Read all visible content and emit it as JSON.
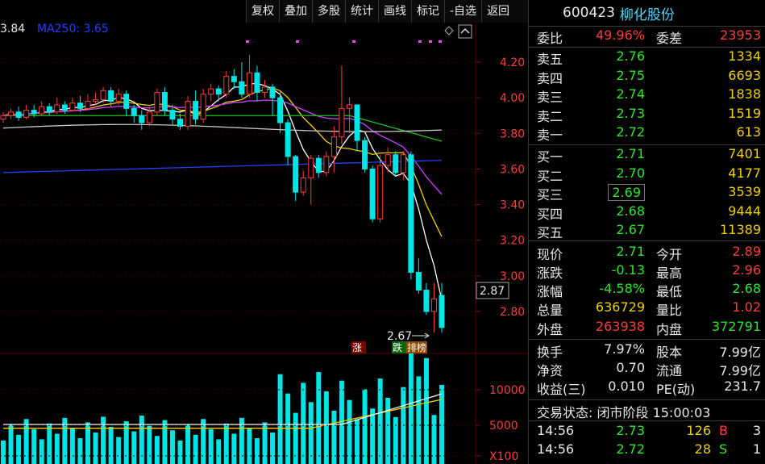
{
  "toolbar": {
    "buttons": [
      "复权",
      "叠加",
      "多股",
      "统计",
      "画线",
      "标记",
      "-自选",
      "返回"
    ]
  },
  "ma_labels": {
    "first": "3.84",
    "ma250": "MA250: 3.65"
  },
  "chart": {
    "price_ticks": [
      "4.20",
      "4.00",
      "3.80",
      "3.60",
      "3.40",
      "3.20",
      "3.00",
      "2.80"
    ],
    "last_price_box": "2.87",
    "min_annotation": "2.67",
    "markers": [
      "涨",
      "跌",
      "排榜"
    ],
    "volume_ticks": [
      "10000",
      "5000",
      "X100"
    ],
    "colors": {
      "up": "#00e5e5",
      "down": "#00e5e5",
      "up_fill": "#000000",
      "ma5": "#ffffff",
      "ma10": "#f0d000",
      "ma20": "#d040ff",
      "ma60": "#20c020",
      "ma120": "#c8c8c8",
      "ma250": "#2040ff",
      "axis_text": "#ff3b3b"
    }
  },
  "stock": {
    "code": "600423",
    "name": "柳化股份"
  },
  "order_book": {
    "weibi_label": "委比",
    "weibi": "49.96%",
    "weicha_label": "委差",
    "weicha": "23953",
    "asks": [
      {
        "label": "卖五",
        "price": "2.76",
        "vol": "1334"
      },
      {
        "label": "卖四",
        "price": "2.75",
        "vol": "6693"
      },
      {
        "label": "卖三",
        "price": "2.74",
        "vol": "1838"
      },
      {
        "label": "卖二",
        "price": "2.73",
        "vol": "1519"
      },
      {
        "label": "卖一",
        "price": "2.72",
        "vol": "613"
      }
    ],
    "bids": [
      {
        "label": "买一",
        "price": "2.71",
        "vol": "7401"
      },
      {
        "label": "买二",
        "price": "2.70",
        "vol": "4177"
      },
      {
        "label": "买三",
        "price": "2.69",
        "vol": "3539"
      },
      {
        "label": "买四",
        "price": "2.68",
        "vol": "9444"
      },
      {
        "label": "买五",
        "price": "2.67",
        "vol": "11389"
      }
    ]
  },
  "quote": {
    "xianjia_label": "现价",
    "xianjia": "2.71",
    "jinkai_label": "今开",
    "jinkai": "2.89",
    "zhangdie_label": "涨跌",
    "zhangdie": "-0.13",
    "zuigao_label": "最高",
    "zuigao": "2.96",
    "zhangfu_label": "涨幅",
    "zhangfu": "-4.58%",
    "zuidi_label": "最低",
    "zuidi": "2.68",
    "zongliang_label": "总量",
    "zongliang": "636729",
    "liangbi_label": "量比",
    "liangbi": "1.02",
    "waipan_label": "外盘",
    "waipan": "263938",
    "neipan_label": "内盘",
    "neipan": "372791"
  },
  "fundamentals": {
    "huanshou_label": "换手",
    "huanshou": "7.97%",
    "guben_label": "股本",
    "guben": "7.99亿",
    "jingzi_label": "净资",
    "jingzi": "0.70",
    "liutong_label": "流通",
    "liutong": "7.99亿",
    "shouyi_label": "收益(三)",
    "shouyi": "0.010",
    "pe_label": "PE(动)",
    "pe": "231.7"
  },
  "trade_status": "交易状态: 闭市阶段 15:00:03",
  "ticks": [
    {
      "time": "14:56",
      "price": "2.73",
      "vol": "126",
      "side": "B",
      "count": "3"
    },
    {
      "time": "14:56",
      "price": "2.72",
      "vol": "28",
      "side": "S",
      "count": "1"
    }
  ]
}
